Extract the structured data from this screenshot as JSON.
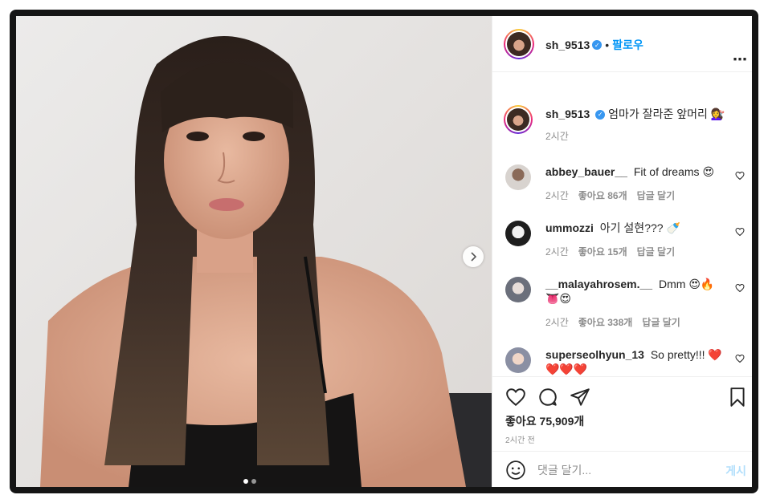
{
  "post": {
    "username": "sh_9513",
    "follow_label": "팔로우",
    "caption": "엄마가 잘라준 앞머리",
    "caption_emoji": "💇‍♀️",
    "caption_time": "2시간",
    "likes": "좋아요 75,909개",
    "posted_time": "2시간 전",
    "carousel": {
      "current": 1,
      "total": 2
    }
  },
  "comments": [
    {
      "username": "abbey_bauer__",
      "text": "Fit of dreams",
      "emoji": "😍",
      "time": "2시간",
      "likes": "좋아요 86개",
      "reply": "답글 달기"
    },
    {
      "username": "ummozzi",
      "text": "아기 설현???",
      "emoji": "🍼",
      "time": "2시간",
      "likes": "좋아요 15개",
      "reply": "답글 달기"
    },
    {
      "username": "__malayahrosem.__",
      "text": "Dmm",
      "emoji": "😍🔥👅😍",
      "time": "2시간",
      "likes": "좋아요 338개",
      "reply": "답글 달기"
    },
    {
      "username": "superseolhyun_13",
      "text": "So pretty!!!",
      "emoji": "❤️❤️❤️❤️",
      "time": "",
      "likes": "",
      "reply": ""
    }
  ],
  "composer": {
    "placeholder": "댓글 달기...",
    "post_label": "게시"
  },
  "icons": {
    "more": "more-horizontal-icon",
    "next": "chevron-right-icon",
    "like": "heart-icon",
    "comment": "comment-bubble-icon",
    "share": "paper-plane-icon",
    "save": "bookmark-icon",
    "emoji": "smiley-icon",
    "verified": "verified-badge-icon"
  },
  "colors": {
    "accent": "#0095f6",
    "text": "#262626",
    "muted": "#8e8e8e",
    "border": "#efefef"
  }
}
